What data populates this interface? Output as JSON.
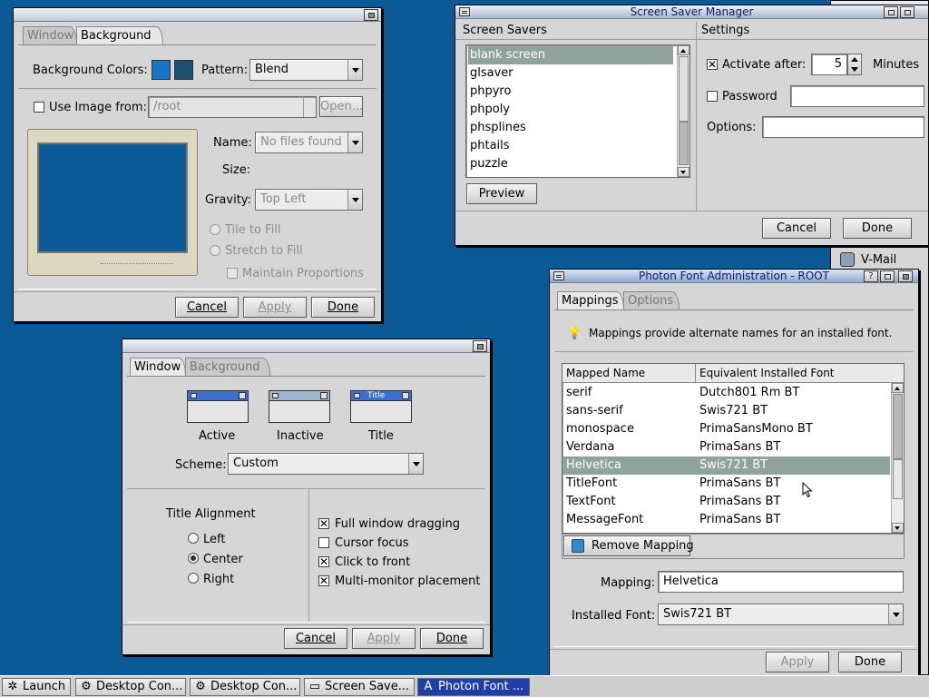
{
  "colors": {
    "desktop": "#0b5a96",
    "window_bg": "#d6d6d6",
    "selection": "#8fa39c",
    "swatch_1": "#1a74c4",
    "swatch_2": "#1e4f70",
    "preview_screen": "#0b5a96",
    "taskbar_active": "#1f3fa8"
  },
  "bg_window": {
    "tabs": [
      "Window",
      "Background"
    ],
    "background_colors_label": "Background Colors:",
    "pattern_label": "Pattern:",
    "pattern_value": "Blend",
    "use_image_label": "Use Image from:",
    "image_path": "/root",
    "open_label": "Open...",
    "name_label": "Name:",
    "name_value": "No files found",
    "size_label": "Size:",
    "gravity_label": "Gravity:",
    "gravity_value": "Top Left",
    "tile_label": "Tile to Fill",
    "stretch_label": "Stretch to Fill",
    "maintain_label": "Maintain Proportions",
    "cancel": "Cancel",
    "apply": "Apply",
    "done": "Done"
  },
  "screensaver": {
    "title": "Screen Saver Manager",
    "savers_header": "Screen Savers",
    "settings_header": "Settings",
    "items": [
      "blank screen",
      "glsaver",
      "phpyro",
      "phpoly",
      "phsplines",
      "phtails",
      "puzzle"
    ],
    "preview": "Preview",
    "activate_label": "Activate after:",
    "activate_value": "5",
    "minutes_label": "Minutes",
    "password_label": "Password",
    "options_label": "Options:",
    "cancel": "Cancel",
    "done": "Done"
  },
  "window_settings": {
    "tabs": [
      "Window",
      "Background"
    ],
    "active_label": "Active",
    "inactive_label": "Inactive",
    "title_label": "Title",
    "mini_title_text": "Title",
    "scheme_label": "Scheme:",
    "scheme_value": "Custom",
    "title_alignment_label": "Title Alignment",
    "align_left": "Left",
    "align_center": "Center",
    "align_right": "Right",
    "full_drag": "Full window dragging",
    "cursor_focus": "Cursor focus",
    "click_front": "Click to front",
    "multi_monitor": "Multi-monitor placement",
    "cancel": "Cancel",
    "apply": "Apply",
    "done": "Done"
  },
  "font_admin": {
    "title": "Photon Font Administration - ROOT",
    "tabs": [
      "Mappings",
      "Options"
    ],
    "info": "Mappings provide alternate names for an installed font.",
    "col_mapped": "Mapped Name",
    "col_installed": "Equivalent Installed Font",
    "rows": [
      {
        "mapped": "serif",
        "installed": "Dutch801 Rm BT"
      },
      {
        "mapped": "sans-serif",
        "installed": "Swis721 BT"
      },
      {
        "mapped": "monospace",
        "installed": "PrimaSansMono BT"
      },
      {
        "mapped": "Verdana",
        "installed": "PrimaSans BT"
      },
      {
        "mapped": "Helvetica",
        "installed": "Swis721 BT"
      },
      {
        "mapped": "TitleFont",
        "installed": "PrimaSans BT"
      },
      {
        "mapped": "TextFont",
        "installed": "PrimaSans BT"
      },
      {
        "mapped": "MessageFont",
        "installed": "PrimaSans BT"
      }
    ],
    "remove_mapping": "Remove Mapping",
    "mapping_label": "Mapping:",
    "mapping_value": "Helvetica",
    "installed_label": "Installed Font:",
    "installed_value": "Swis721 BT",
    "apply": "Apply",
    "done": "Done"
  },
  "side_items": {
    "vmail": "V-Mail"
  },
  "taskbar": {
    "launch": "Launch",
    "items": [
      "Desktop Con...",
      "Desktop Con...",
      "Screen Save...",
      "Photon Font ..."
    ]
  }
}
